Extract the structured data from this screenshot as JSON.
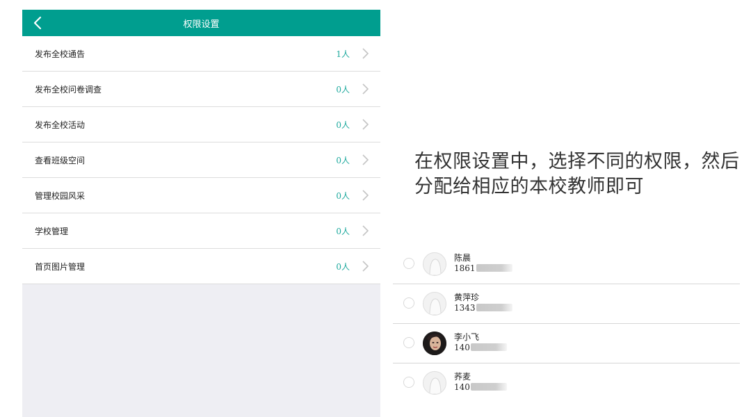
{
  "navbar": {
    "title": "权限设置",
    "back_icon": "chevron-left-icon"
  },
  "permissions": [
    {
      "label": "发布全校通告",
      "count": "1人"
    },
    {
      "label": "发布全校问卷调查",
      "count": "0人"
    },
    {
      "label": "发布全校活动",
      "count": "0人"
    },
    {
      "label": "查看班级空间",
      "count": "0人"
    },
    {
      "label": "管理校园风采",
      "count": "0人"
    },
    {
      "label": "学校管理",
      "count": "0人"
    },
    {
      "label": "首页图片管理",
      "count": "0人"
    }
  ],
  "caption": "在权限设置中，选择不同的权限，然后分配给相应的本校教师即可",
  "contacts": [
    {
      "name": "陈晨",
      "phone": "1861",
      "avatar": "default-avatar-icon"
    },
    {
      "name": "黄萍珍",
      "phone": "1343",
      "avatar": "default-avatar-icon"
    },
    {
      "name": "李小飞",
      "phone": "140",
      "avatar": "photo-avatar"
    },
    {
      "name": "荞麦",
      "phone": "140",
      "avatar": "default-avatar-icon"
    }
  ],
  "colors": {
    "accent": "#009e8f",
    "count_text": "#1aa89c",
    "panel_bg": "#eeeef3"
  }
}
